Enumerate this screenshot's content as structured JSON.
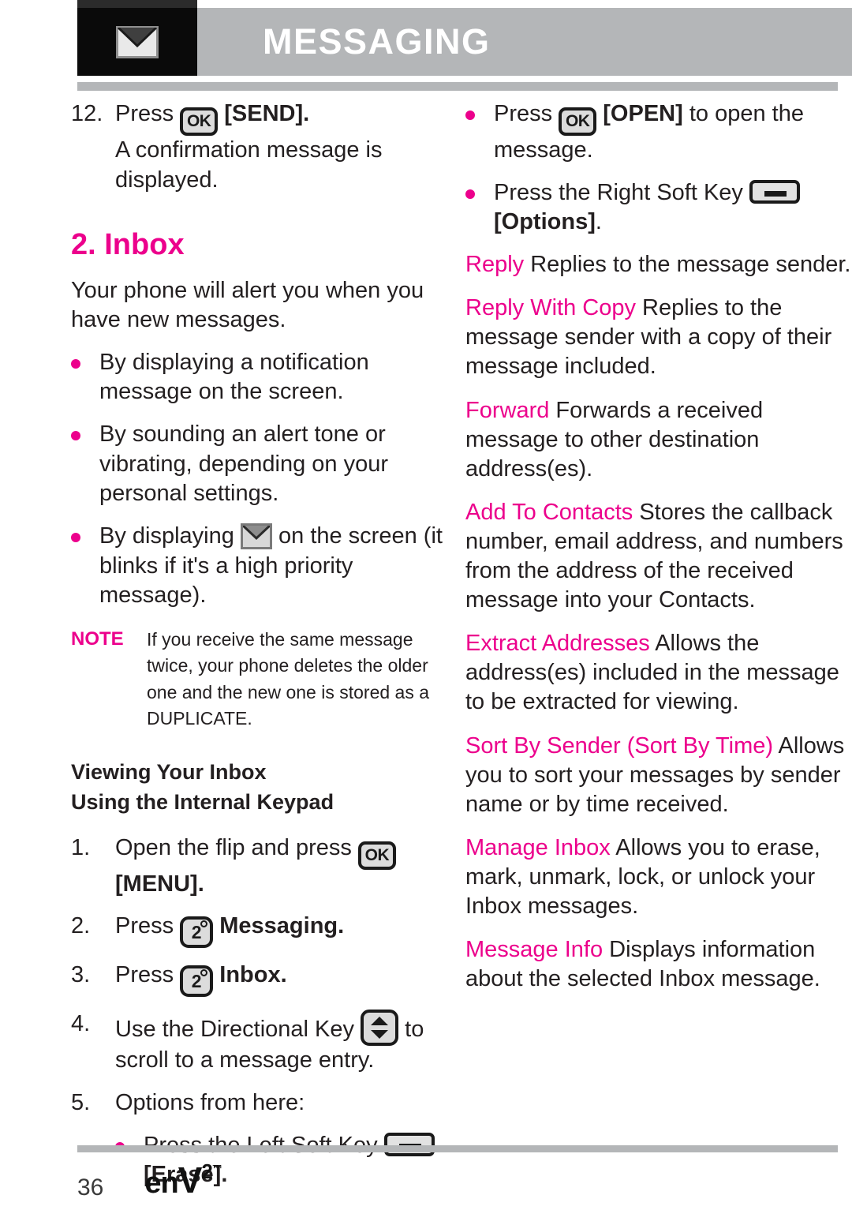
{
  "header": {
    "title": "MESSAGING",
    "icon": "envelope-icon"
  },
  "colors": {
    "accent_pink": "#EC008C",
    "header_gray": "#b4b6b8",
    "icon_box_black": "#0a0a0a",
    "body_text": "#231f20"
  },
  "left_column": {
    "step12": {
      "num": "12.",
      "press": "Press",
      "key": "OK",
      "label": "[SEND].",
      "detail": "A confirmation message is displayed."
    },
    "section": {
      "title": "2. Inbox",
      "intro": "Your phone will alert you when you have new messages."
    },
    "alert_bullets": [
      {
        "text": "By displaying a notification message  on the screen."
      },
      {
        "text": "By sounding an alert tone or vibrating, depending on your personal settings."
      },
      {
        "pre": "By displaying",
        "icon": "envelope-icon",
        "post": "on the screen (it blinks if it's a high priority message)."
      }
    ],
    "note": {
      "label": "NOTE",
      "text": "If you receive the same message twice, your phone deletes the older one and the new one is stored as a DUPLICATE."
    },
    "subheads": [
      "Viewing Your Inbox",
      "Using the Internal Keypad"
    ],
    "steps": [
      {
        "num": "1.",
        "pre": "Open the flip and press",
        "key": "OK",
        "post": "[MENU]."
      },
      {
        "num": "2.",
        "pre": "Press",
        "key": "2",
        "post": "Messaging."
      },
      {
        "num": "3.",
        "pre": "Press",
        "key": "2",
        "post": "Inbox."
      },
      {
        "num": "4.",
        "pre": "Use the Directional Key",
        "key": "directional",
        "post": "to scroll to a message entry."
      },
      {
        "num": "5.",
        "pre": "Options from here:",
        "key": "",
        "post": ""
      }
    ],
    "sub_bullet": {
      "pre": "Press the Left Soft Key",
      "key": "soft",
      "post": "[Erase]."
    }
  },
  "right_column": {
    "bullets": [
      {
        "pre": "Press",
        "key": "OK",
        "bold": "[OPEN]",
        "post": "to open the message."
      },
      {
        "pre": "Press the Right Soft Key",
        "key": "soft",
        "bold": "[Options]",
        "post": "."
      }
    ],
    "options": [
      {
        "name": "Reply",
        "desc": "Replies to the message sender."
      },
      {
        "name": "Reply With Copy",
        "desc": "Replies to the message sender with a copy of their message included."
      },
      {
        "name": "Forward",
        "desc": "Forwards a received message to other destination address(es)."
      },
      {
        "name": "Add To Contacts",
        "desc": "Stores the callback number, email address, and numbers from the address of the received message into your Contacts."
      },
      {
        "name": "Extract Addresses",
        "desc": "Allows the address(es) included in the message to be extracted for viewing."
      },
      {
        "name": "Sort By Sender (Sort By Time)",
        "desc": "Allows you to sort your messages by sender name or by time received."
      },
      {
        "name": "Manage Inbox",
        "desc": "Allows you to erase, mark, unmark, lock, or unlock your Inbox messages."
      },
      {
        "name": "Message Info",
        "desc": "Displays information about the selected Inbox message."
      }
    ]
  },
  "footer": {
    "page_number": "36",
    "logo_en": "en",
    "logo_v": "V",
    "logo_two": "2",
    "logo_tm": "™"
  }
}
